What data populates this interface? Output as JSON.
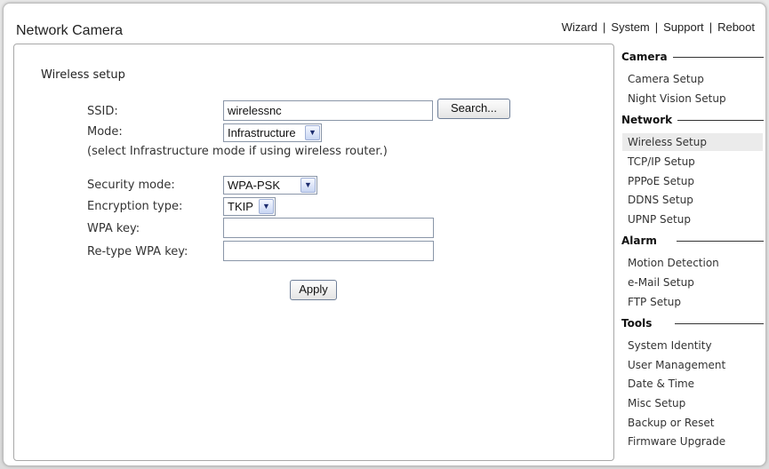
{
  "app": {
    "title": "Network Camera"
  },
  "topnav": {
    "items": [
      "Wizard",
      "System",
      "Support",
      "Reboot"
    ],
    "separator": "|"
  },
  "main": {
    "section_title": "Wireless setup",
    "ssid": {
      "label": "SSID:",
      "value": "wirelessnc",
      "search_label": "Search..."
    },
    "mode": {
      "label": "Mode:",
      "selected": "Infrastructure",
      "note": "(select Infrastructure mode if using wireless router.)"
    },
    "security": {
      "label": "Security mode:",
      "selected": "WPA-PSK"
    },
    "encryption": {
      "label": "Encryption type:",
      "selected": "TKIP"
    },
    "wpa_key": {
      "label": "WPA key:",
      "value": ""
    },
    "retype_key": {
      "label": "Re-type WPA key:",
      "value": ""
    },
    "apply_label": "Apply"
  },
  "sidebar": {
    "camera": {
      "title": "Camera",
      "items": [
        "Camera Setup",
        "Night Vision Setup"
      ]
    },
    "network": {
      "title": "Network",
      "items": [
        "Wireless Setup",
        "TCP/IP Setup",
        "PPPoE Setup",
        "DDNS Setup",
        "UPNP Setup"
      ],
      "active": "Wireless Setup"
    },
    "alarm": {
      "title": "Alarm",
      "items": [
        "Motion Detection",
        "e-Mail Setup",
        "FTP Setup"
      ]
    },
    "tools": {
      "title": "Tools",
      "items": [
        "System Identity",
        "User Management",
        "Date & Time",
        "Misc Setup",
        "Backup or Reset",
        "Firmware Upgrade"
      ]
    }
  },
  "icons": {
    "dropdown": "chevron-down-icon"
  },
  "colors": {
    "active_item_bg": "#ebebeb",
    "border": "#a8a8a8"
  }
}
